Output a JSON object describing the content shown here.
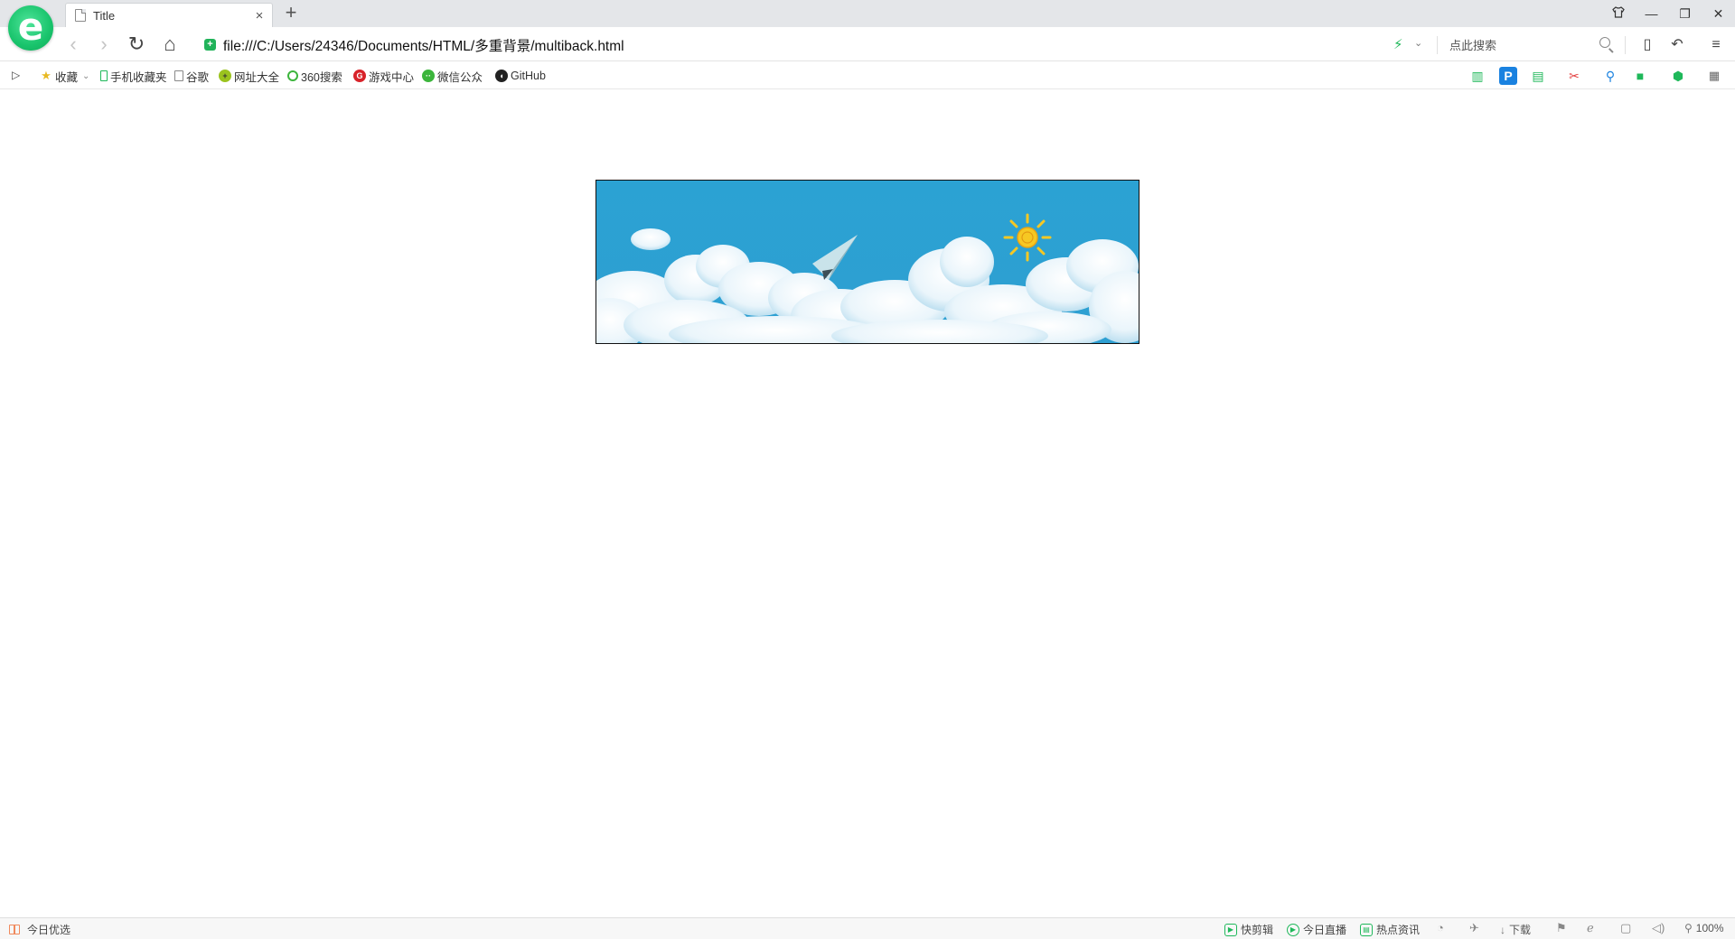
{
  "tab": {
    "title": "Title"
  },
  "window": {
    "new_tab": "+",
    "skin": "👕",
    "minimize": "—",
    "restore": "❐",
    "close": "✕"
  },
  "nav": {
    "back": "‹",
    "forward": "›",
    "refresh": "↻",
    "home": "⌂",
    "secure_mark": "+",
    "address": "file:///C:/Users/24346/Documents/HTML/多重背景/multiback.html",
    "bolt": "⚡",
    "dropdown": "⌄",
    "search_placeholder": "点此搜索",
    "reader": "▯",
    "undo": "↶",
    "menu": "≡"
  },
  "bookmarks": {
    "toggle": "▷",
    "items": [
      {
        "label": "收藏",
        "icon": "star-icon"
      },
      {
        "label": "手机收藏夹",
        "icon": "phone-icon"
      },
      {
        "label": "谷歌",
        "icon": "page-icon"
      },
      {
        "label": "网址大全",
        "icon": "web-icon"
      },
      {
        "label": "360搜索",
        "icon": "360-icon"
      },
      {
        "label": "游戏中心",
        "icon": "game-center-icon"
      },
      {
        "label": "微信公众",
        "icon": "wechat-icon"
      },
      {
        "label": "GitHub",
        "icon": "github-icon"
      }
    ],
    "right_icons": [
      "book-icon",
      "p-icon",
      "translate-icon",
      "scissors-icon",
      "magnifier-icon",
      "gamepad-icon",
      "shield-icon",
      "apps-icon"
    ],
    "p_label": "P"
  },
  "statusbar": {
    "today_picks": "今日优选",
    "quick_clip": "快剪辑",
    "live_today": "今日直播",
    "hot_news": "热点资讯",
    "download": "下载",
    "zoom": "100%"
  },
  "colors": {
    "sky": "#2ba2d3",
    "brand_green": "#1fb85a",
    "sun": "#f6c823"
  }
}
